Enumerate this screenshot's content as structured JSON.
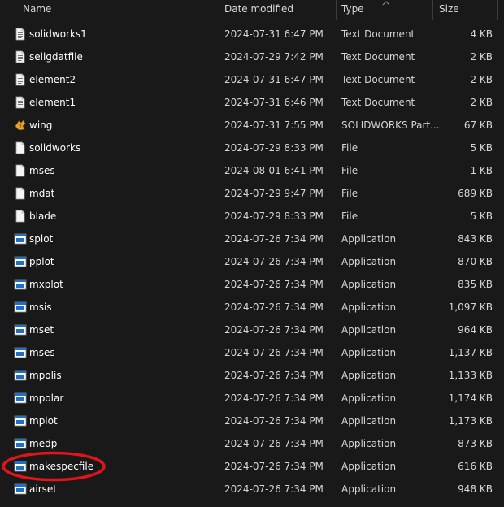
{
  "columns": {
    "name": "Name",
    "date": "Date modified",
    "type": "Type",
    "size": "Size"
  },
  "files": [
    {
      "name": "solidworks1",
      "date": "2024-07-31 6:47 PM",
      "type": "Text Document",
      "size": "4 KB",
      "icon": "text-document-icon"
    },
    {
      "name": "seligdatfile",
      "date": "2024-07-29 7:42 PM",
      "type": "Text Document",
      "size": "2 KB",
      "icon": "text-document-icon"
    },
    {
      "name": "element2",
      "date": "2024-07-31 6:47 PM",
      "type": "Text Document",
      "size": "2 KB",
      "icon": "text-document-icon"
    },
    {
      "name": "element1",
      "date": "2024-07-31 6:46 PM",
      "type": "Text Document",
      "size": "2 KB",
      "icon": "text-document-icon"
    },
    {
      "name": "wing",
      "date": "2024-07-31 7:55 PM",
      "type": "SOLIDWORKS Part...",
      "size": "67 KB",
      "icon": "solidworks-part-icon"
    },
    {
      "name": "solidworks",
      "date": "2024-07-29 8:33 PM",
      "type": "File",
      "size": "5 KB",
      "icon": "blank-file-icon"
    },
    {
      "name": "mses",
      "date": "2024-08-01 6:41 PM",
      "type": "File",
      "size": "1 KB",
      "icon": "blank-file-icon"
    },
    {
      "name": "mdat",
      "date": "2024-07-29 9:47 PM",
      "type": "File",
      "size": "689 KB",
      "icon": "blank-file-icon"
    },
    {
      "name": "blade",
      "date": "2024-07-29 8:33 PM",
      "type": "File",
      "size": "5 KB",
      "icon": "blank-file-icon"
    },
    {
      "name": "splot",
      "date": "2024-07-26 7:34 PM",
      "type": "Application",
      "size": "843 KB",
      "icon": "application-icon"
    },
    {
      "name": "pplot",
      "date": "2024-07-26 7:34 PM",
      "type": "Application",
      "size": "870 KB",
      "icon": "application-icon"
    },
    {
      "name": "mxplot",
      "date": "2024-07-26 7:34 PM",
      "type": "Application",
      "size": "835 KB",
      "icon": "application-icon"
    },
    {
      "name": "msis",
      "date": "2024-07-26 7:34 PM",
      "type": "Application",
      "size": "1,097 KB",
      "icon": "application-icon"
    },
    {
      "name": "mset",
      "date": "2024-07-26 7:34 PM",
      "type": "Application",
      "size": "964 KB",
      "icon": "application-icon"
    },
    {
      "name": "mses",
      "date": "2024-07-26 7:34 PM",
      "type": "Application",
      "size": "1,137 KB",
      "icon": "application-icon"
    },
    {
      "name": "mpolis",
      "date": "2024-07-26 7:34 PM",
      "type": "Application",
      "size": "1,133 KB",
      "icon": "application-icon"
    },
    {
      "name": "mpolar",
      "date": "2024-07-26 7:34 PM",
      "type": "Application",
      "size": "1,174 KB",
      "icon": "application-icon"
    },
    {
      "name": "mplot",
      "date": "2024-07-26 7:34 PM",
      "type": "Application",
      "size": "1,173 KB",
      "icon": "application-icon"
    },
    {
      "name": "medp",
      "date": "2024-07-26 7:34 PM",
      "type": "Application",
      "size": "873 KB",
      "icon": "application-icon"
    },
    {
      "name": "makespecfile",
      "date": "2024-07-26 7:34 PM",
      "type": "Application",
      "size": "616 KB",
      "icon": "application-icon",
      "highlighted": true
    },
    {
      "name": "airset",
      "date": "2024-07-26 7:34 PM",
      "type": "Application",
      "size": "948 KB",
      "icon": "application-icon"
    }
  ],
  "colors": {
    "background": "#191919",
    "highlight_ring": "#e0151b",
    "app_icon_blue": "#1e6fc8"
  }
}
